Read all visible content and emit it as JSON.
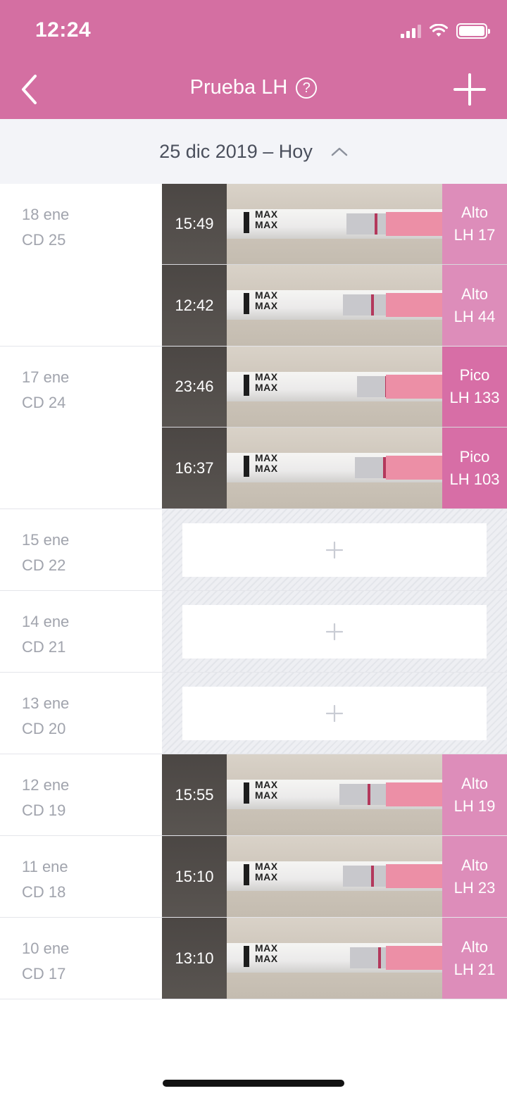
{
  "status_bar": {
    "time": "12:24"
  },
  "nav": {
    "title": "Prueba LH",
    "back_icon": "chevron-left-icon",
    "help_icon": "question-circle-icon",
    "add_icon": "plus-icon",
    "help_glyph": "?"
  },
  "range": {
    "label": "25 dic 2019 – Hoy",
    "toggle_icon": "chevron-up-icon"
  },
  "colors": {
    "header": "#d46fa2",
    "alto": "#dd8dba",
    "pico": "#d76ea6"
  },
  "days": [
    {
      "date": "18 ene",
      "cycle_day": "CD 25",
      "tests": [
        {
          "time": "15:49",
          "result": "Alto",
          "value": "LH 17",
          "level": "alto"
        },
        {
          "time": "12:42",
          "result": "Alto",
          "value": "LH 44",
          "level": "alto"
        }
      ]
    },
    {
      "date": "17 ene",
      "cycle_day": "CD 24",
      "tests": [
        {
          "time": "23:46",
          "result": "Pico",
          "value": "LH 133",
          "level": "pico"
        },
        {
          "time": "16:37",
          "result": "Pico",
          "value": "LH 103",
          "level": "pico"
        }
      ]
    },
    {
      "date": "15 ene",
      "cycle_day": "CD 22",
      "tests": []
    },
    {
      "date": "14 ene",
      "cycle_day": "CD 21",
      "tests": []
    },
    {
      "date": "13 ene",
      "cycle_day": "CD 20",
      "tests": []
    },
    {
      "date": "12 ene",
      "cycle_day": "CD 19",
      "tests": [
        {
          "time": "15:55",
          "result": "Alto",
          "value": "LH 19",
          "level": "alto"
        }
      ]
    },
    {
      "date": "11 ene",
      "cycle_day": "CD 18",
      "tests": [
        {
          "time": "15:10",
          "result": "Alto",
          "value": "LH 23",
          "level": "alto"
        }
      ]
    },
    {
      "date": "10 ene",
      "cycle_day": "CD 17",
      "tests": [
        {
          "time": "13:10",
          "result": "Alto",
          "value": "LH 21",
          "level": "alto"
        }
      ]
    }
  ],
  "strip_text": "MAX"
}
